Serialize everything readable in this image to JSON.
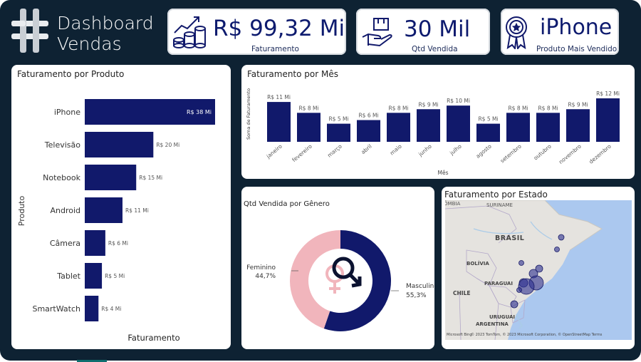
{
  "header": {
    "title_line1": "Dashboard",
    "title_line2": "Vendas"
  },
  "kpis": {
    "revenue": {
      "value": "R$ 99,32 Mi",
      "label": "Faturamento"
    },
    "quantity": {
      "value": "30 Mil",
      "label": "Qtd Vendida"
    },
    "top_product": {
      "value": "iPhone",
      "label": "Produto Mais Vendido"
    }
  },
  "colors": {
    "bar": "#11196b",
    "female": "#f1b5bc",
    "male": "#11196b",
    "background": "#0e2233"
  },
  "chart_data": [
    {
      "type": "bar",
      "orientation": "horizontal",
      "title": "Faturamento por Produto",
      "xlabel": "Faturamento",
      "ylabel": "Produto",
      "categories": [
        "iPhone",
        "Televisão",
        "Notebook",
        "Android",
        "Câmera",
        "Tablet",
        "SmartWatch"
      ],
      "values": [
        38,
        20,
        15,
        11,
        6,
        5,
        4
      ],
      "data_labels": [
        "R$ 38 Mi",
        "R$ 20 Mi",
        "R$ 15 Mi",
        "R$ 11 Mi",
        "R$ 6 Mi",
        "R$ 5 Mi",
        "R$ 4 Mi"
      ],
      "xlim": [
        0,
        38
      ]
    },
    {
      "type": "bar",
      "title": "Faturamento por Mês",
      "xlabel": "Mês",
      "ylabel": "Soma de Faturamento",
      "categories": [
        "janeiro",
        "fevereiro",
        "março",
        "abril",
        "maio",
        "junho",
        "julho",
        "agosto",
        "setembro",
        "outubro",
        "novembro",
        "dezembro"
      ],
      "values": [
        11,
        8,
        5,
        6,
        8,
        9,
        10,
        5,
        8,
        8,
        9,
        12
      ],
      "data_labels": [
        "R$ 11 Mi",
        "R$ 8 Mi",
        "R$ 5 Mi",
        "R$ 6 Mi",
        "R$ 8 Mi",
        "R$ 9 Mi",
        "R$ 10 Mi",
        "R$ 5 Mi",
        "R$ 8 Mi",
        "R$ 8 Mi",
        "R$ 9 Mi",
        "R$ 12 Mi"
      ],
      "ylim": [
        0,
        12
      ]
    },
    {
      "type": "pie",
      "donut": true,
      "title": "Qtd Vendida por Gênero",
      "series": [
        {
          "name": "Feminino",
          "value": 44.7,
          "label": "44,7%"
        },
        {
          "name": "Masculino",
          "value": 55.3,
          "label": "55,3%"
        }
      ]
    }
  ],
  "map": {
    "title": "Faturamento por Estado",
    "labels": {
      "colombia": "COLÔMBIA",
      "suriname": "SURINAME",
      "brasil": "BRASIL",
      "bolivia": "BOLÍVIA",
      "paraguai": "PARAGUAI",
      "chile": "CHILE",
      "uruguai": "URUGUAI",
      "argentina": "ARGENTINA"
    },
    "attribution": "© 2023 TomTom, © 2023 Microsoft Corporation, © OpenStreetMap  Terms",
    "provider": "Microsoft Bing"
  }
}
